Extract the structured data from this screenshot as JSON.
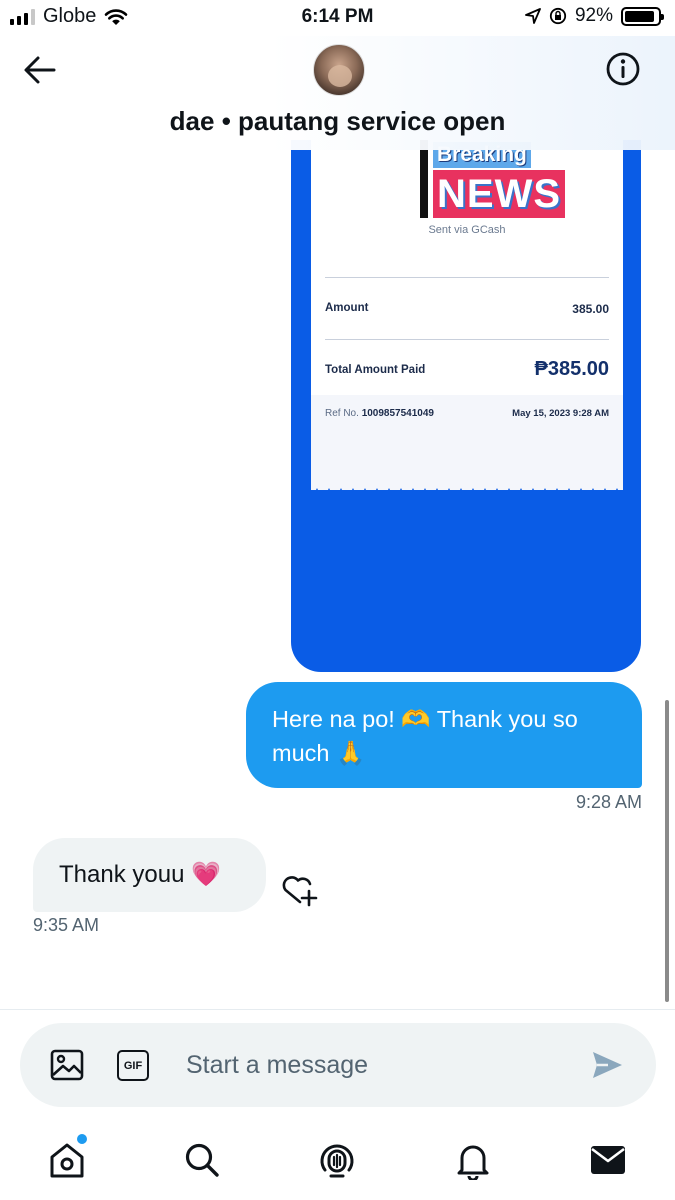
{
  "status_bar": {
    "carrier": "Globe",
    "time": "6:14 PM",
    "battery": "92%",
    "battery_level": 0.92
  },
  "header": {
    "title": "dae • pautang service open",
    "back_icon": "arrow-left-icon",
    "info_icon": "info-icon"
  },
  "receipt": {
    "banner_line1": "Breaking",
    "banner_line2": "NEWS",
    "sent_via": "Sent via GCash",
    "amount_label": "Amount",
    "amount_value": "385.00",
    "total_label": "Total Amount Paid",
    "total_value": "₱385.00",
    "ref_label": "Ref No.",
    "ref_number": "1009857541049",
    "date": "May 15, 2023 9:28 AM",
    "colors": {
      "frame": "#0a5ce6",
      "news": "#e8325f",
      "breaking": "#5ea8ea"
    }
  },
  "messages": [
    {
      "direction": "outgoing",
      "text": "Here na po! 🫶 Thank you so much 🙏",
      "time": "9:28 AM"
    },
    {
      "direction": "incoming",
      "text": "Thank youu 💗",
      "time": "9:35 AM"
    }
  ],
  "composer": {
    "placeholder": "Start a message",
    "gif_label": "GIF"
  },
  "nav": {
    "items": [
      "home-icon",
      "search-icon",
      "spaces-icon",
      "notifications-icon",
      "messages-icon"
    ]
  },
  "colors": {
    "accent": "#1d9bf0",
    "incoming_bubble": "#eff3f4",
    "secondary_text": "#536471"
  }
}
